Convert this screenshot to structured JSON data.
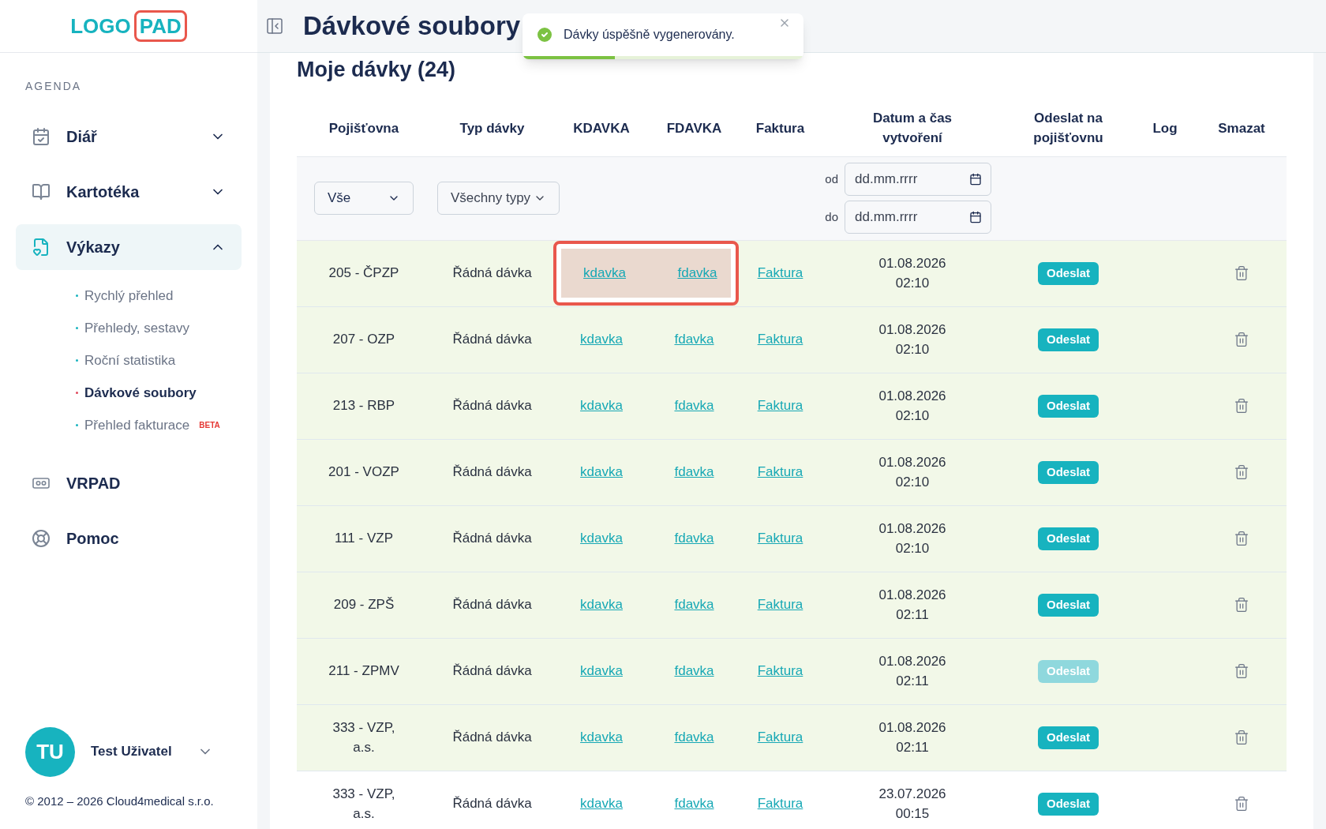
{
  "logo": {
    "word": "LOGO",
    "boxed": "PAD"
  },
  "sidebar": {
    "section": "AGENDA",
    "items": [
      {
        "label": "Diář",
        "expanded": false,
        "selected": false
      },
      {
        "label": "Kartotéka",
        "expanded": false,
        "selected": false
      },
      {
        "label": "Výkazy",
        "expanded": true,
        "selected": true,
        "children": [
          {
            "label": "Rychlý přehled",
            "selected": false
          },
          {
            "label": "Přehledy, sestavy",
            "selected": false
          },
          {
            "label": "Roční statistika",
            "selected": false
          },
          {
            "label": "Dávkové soubory",
            "selected": true
          },
          {
            "label": "Přehled fakturace",
            "selected": false,
            "badge": "BETA"
          }
        ]
      },
      {
        "label": "VRPAD",
        "selected": false
      },
      {
        "label": "Pomoc",
        "selected": false
      }
    ],
    "user": {
      "initials": "TU",
      "name": "Test Uživatel"
    },
    "footer": "© 2012 – 2026 Cloud4medical s.r.o."
  },
  "page_title": "Dávkové soubory",
  "toast": {
    "message": "Dávky úspěšně vygenerovány.",
    "level": 0.33
  },
  "card_title": "Moje dávky (24)",
  "table": {
    "columns": [
      "Pojišťovna",
      "Typ dávky",
      "KDAVKA",
      "FDAVKA",
      "Faktura",
      "Datum a čas vytvoření",
      "Odeslat na pojišťovnu",
      "Log",
      "Smazat"
    ],
    "filters": {
      "insurer": "Vše",
      "type": "Všechny typy",
      "from_label": "od",
      "from_placeholder": "dd.mm.rrrr",
      "to_label": "do",
      "to_placeholder": "dd.mm.rrrr"
    },
    "rows": [
      {
        "insurer": "205 - ČPZP",
        "type": "Řádná dávka",
        "kdavka": "kdavka",
        "fdavka": "fdavka",
        "invoice": "Faktura",
        "date": "01.08.2026",
        "time": "02:10",
        "send": "Odeslat",
        "send_disabled": false,
        "highlighted": true,
        "annotated": true
      },
      {
        "insurer": "207 - OZP",
        "type": "Řádná dávka",
        "kdavka": "kdavka",
        "fdavka": "fdavka",
        "invoice": "Faktura",
        "date": "01.08.2026",
        "time": "02:10",
        "send": "Odeslat",
        "send_disabled": false,
        "highlighted": true,
        "annotated": false
      },
      {
        "insurer": "213 - RBP",
        "type": "Řádná dávka",
        "kdavka": "kdavka",
        "fdavka": "fdavka",
        "invoice": "Faktura",
        "date": "01.08.2026",
        "time": "02:10",
        "send": "Odeslat",
        "send_disabled": false,
        "highlighted": true,
        "annotated": false
      },
      {
        "insurer": "201 - VOZP",
        "type": "Řádná dávka",
        "kdavka": "kdavka",
        "fdavka": "fdavka",
        "invoice": "Faktura",
        "date": "01.08.2026",
        "time": "02:10",
        "send": "Odeslat",
        "send_disabled": false,
        "highlighted": true,
        "annotated": false
      },
      {
        "insurer": "111 - VZP",
        "type": "Řádná dávka",
        "kdavka": "kdavka",
        "fdavka": "fdavka",
        "invoice": "Faktura",
        "date": "01.08.2026",
        "time": "02:10",
        "send": "Odeslat",
        "send_disabled": false,
        "highlighted": true,
        "annotated": false
      },
      {
        "insurer": "209 - ZPŠ",
        "type": "Řádná dávka",
        "kdavka": "kdavka",
        "fdavka": "fdavka",
        "invoice": "Faktura",
        "date": "01.08.2026",
        "time": "02:11",
        "send": "Odeslat",
        "send_disabled": false,
        "highlighted": true,
        "annotated": false
      },
      {
        "insurer": "211 - ZPMV",
        "type": "Řádná dávka",
        "kdavka": "kdavka",
        "fdavka": "fdavka",
        "invoice": "Faktura",
        "date": "01.08.2026",
        "time": "02:11",
        "send": "Odeslat",
        "send_disabled": true,
        "highlighted": true,
        "annotated": false
      },
      {
        "insurer": "333 - VZP, a.s.",
        "type": "Řádná dávka",
        "kdavka": "kdavka",
        "fdavka": "fdavka",
        "invoice": "Faktura",
        "date": "01.08.2026",
        "time": "02:11",
        "send": "Odeslat",
        "send_disabled": false,
        "highlighted": true,
        "annotated": false
      },
      {
        "insurer": "333 - VZP, a.s.",
        "type": "Řádná dávka",
        "kdavka": "kdavka",
        "fdavka": "fdavka",
        "invoice": "Faktura",
        "date": "23.07.2026",
        "time": "00:15",
        "send": "Odeslat",
        "send_disabled": false,
        "highlighted": false,
        "annotated": false
      }
    ]
  }
}
